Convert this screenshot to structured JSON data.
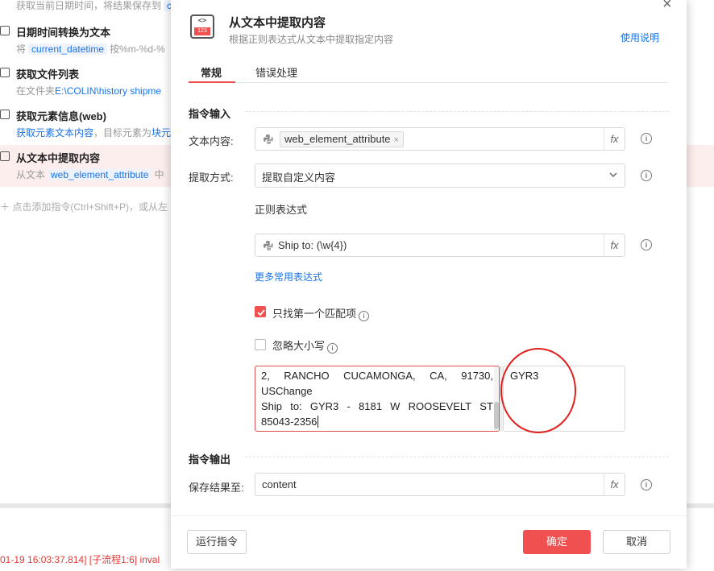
{
  "background": {
    "items": [
      {
        "title": "",
        "desc_prefix": "获取当前日期时间，将结果保存到",
        "desc_chip": "c"
      },
      {
        "title": "日期时间转换为文本",
        "desc_prefix": "将",
        "desc_chip": "current_datetime",
        "desc_suffix": "按%m-%d-%"
      },
      {
        "title": "获取文件列表",
        "desc_prefix": "在文件夹",
        "desc_blue": "E:\\COLIN\\history shipme"
      },
      {
        "title": "获取元素信息(web)",
        "desc_blue": "获取元素文本内容",
        "desc_suffix": "，目标元素为",
        "desc_blue2": "块元"
      },
      {
        "title": "从文本中提取内容",
        "desc_prefix": "从文本",
        "desc_chip": "web_element_attribute",
        "desc_suffix": "中"
      }
    ],
    "add_command": "＋  点击添加指令(Ctrl+Shift+P)，或从左",
    "log_line": "01-19 16:03:37.814] [子流程1:6]  inval"
  },
  "dialog": {
    "icon_code": "<>",
    "icon_number": "123",
    "title": "从文本中提取内容",
    "subtitle": "根据正则表达式从文本中提取指定内容",
    "help_link": "使用说明",
    "close": "×",
    "tabs": [
      {
        "label": "常规",
        "active": true
      },
      {
        "label": "错误处理",
        "active": false
      }
    ],
    "input_section": "指令输入",
    "output_section": "指令输出",
    "text_content": {
      "label": "文本内容:",
      "tag": "web_element_attribute",
      "tag_close": "×",
      "fx": "fx"
    },
    "extract_mode": {
      "label": "提取方式:",
      "value": "提取自定义内容"
    },
    "regex": {
      "label": "正则表达式",
      "value": "Ship to: (\\w{4})",
      "fx": "fx"
    },
    "more_regex_link": "更多常用表达式",
    "first_match": {
      "label": "只找第一个匹配项",
      "checked": true
    },
    "ignore_case": {
      "label": "忽略大小写",
      "checked": false
    },
    "test_text": {
      "line1_words": [
        "2,",
        "RANCHO",
        "CUCAMONGA,",
        "CA,",
        "91730,"
      ],
      "line2": "USChange",
      "line3_words": [
        "Ship",
        "to:",
        "GYR3",
        "-",
        "8181",
        "W",
        "ROOSEVELT",
        "ST"
      ],
      "line4": "85043-2356"
    },
    "test_result": "GYR3",
    "save_to": {
      "label": "保存结果至:",
      "value": "content",
      "fx": "fx"
    },
    "info": "i",
    "buttons": {
      "run": "运行指令",
      "ok": "确定",
      "cancel": "取消"
    },
    "accent_color": "#f05050"
  }
}
